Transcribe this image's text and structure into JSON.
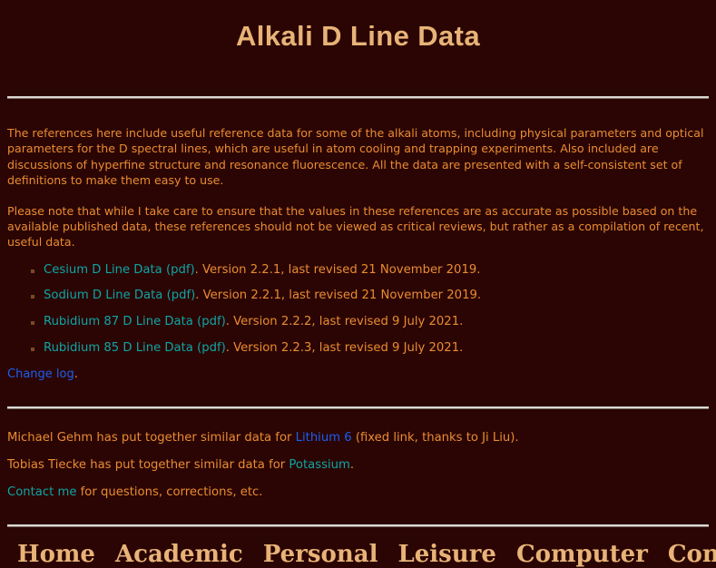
{
  "page": {
    "title": "Alkali D Line Data",
    "background_color": "#2b0503",
    "text_color": "#ea8c32",
    "heading_color": "#e8b377",
    "visited_link_color": "#0fa5a5",
    "new_link_color": "#1b5ef0"
  },
  "intro": {
    "paragraph_1": "The references here include useful reference data for some of the alkali atoms, including physical parameters and optical parameters for the D spectral lines, which are useful in atom cooling and trapping experiments. Also included are discussions of hyperfine structure and resonance fluorescence. All the data are presented with a self-consistent set of definitions to make them easy to use.",
    "paragraph_2": "Please note that while I take care to ensure that the values in these references are as accurate as possible based on the available published data, these references should not be viewed as critical reviews, but rather as a compilation of recent, useful data."
  },
  "references": [
    {
      "name": "Cesium D Line Data",
      "pdf_label": "(pdf)",
      "detail": ". Version 2.2.1, last revised 21 November 2019."
    },
    {
      "name": "Sodium D Line Data",
      "pdf_label": "(pdf)",
      "detail": ". Version 2.2.1, last revised 21 November 2019."
    },
    {
      "name": "Rubidium 87 D Line Data",
      "pdf_label": "(pdf)",
      "detail": ". Version 2.2.2, last revised 9 July 2021."
    },
    {
      "name": "Rubidium 85 D Line Data",
      "pdf_label": "(pdf)",
      "detail": ". Version 2.2.3, last revised 9 July 2021."
    }
  ],
  "change_log": {
    "link_label": "Change log",
    "trailing": "."
  },
  "notes": [
    {
      "prefix": "Michael Gehm has put together similar data for ",
      "link_label": "Lithium 6",
      "link_style": "new",
      "suffix": " (fixed link, thanks to Ji Liu)."
    },
    {
      "prefix": "Tobias Tiecke has put together similar data for ",
      "link_label": "Potassium",
      "link_style": "visited",
      "suffix": "."
    },
    {
      "prefix": "",
      "link_label": "Contact me",
      "link_style": "visited",
      "suffix": " for questions, corrections, etc."
    }
  ],
  "footer_nav": [
    {
      "label": "Home"
    },
    {
      "label": "Academic"
    },
    {
      "label": "Personal"
    },
    {
      "label": "Leisure"
    },
    {
      "label": "Computer"
    },
    {
      "label": "Contact"
    }
  ]
}
